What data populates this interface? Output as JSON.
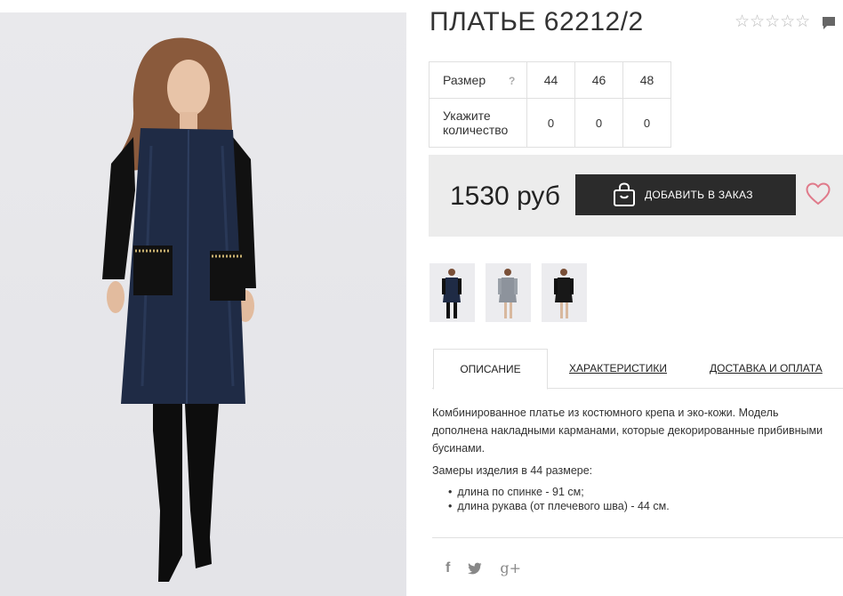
{
  "product": {
    "title": "ПЛАТЬЕ 62212/2",
    "rating_icon": "star-outline-icon",
    "rating_stars": "☆☆☆☆☆",
    "rating_value": 0
  },
  "sizes": {
    "size_label": "Размер",
    "help": "?",
    "values": [
      "44",
      "46",
      "48"
    ],
    "qty_label_line1": "Укажите",
    "qty_label_line2": "количество",
    "quantities": [
      "0",
      "0",
      "0"
    ]
  },
  "purchase": {
    "price": "1530 руб",
    "button_label": "ДОБАВИТЬ В ЗАКАЗ",
    "accent_color": "#e07a8a"
  },
  "tabs": [
    {
      "label": "ОПИСАНИЕ",
      "active": true
    },
    {
      "label": "ХАРАКТЕРИСТИКИ",
      "active": false
    },
    {
      "label": "ДОСТАВКА И ОПЛАТА",
      "active": false
    }
  ],
  "description": {
    "text": "Комбинированное платье из костюмного крепа и эко-кожи. Модель дополнена накладными карманами, которые декорированные прибивными бусинами.",
    "measures_title": "Замеры изделия в 44 размере:",
    "measures": [
      "длина по спинке - 91 см;",
      "длина рукава (от плечевого шва) - 44 см."
    ]
  },
  "social": {
    "facebook": "f",
    "twitter": "🐦",
    "googleplus": "g+"
  }
}
